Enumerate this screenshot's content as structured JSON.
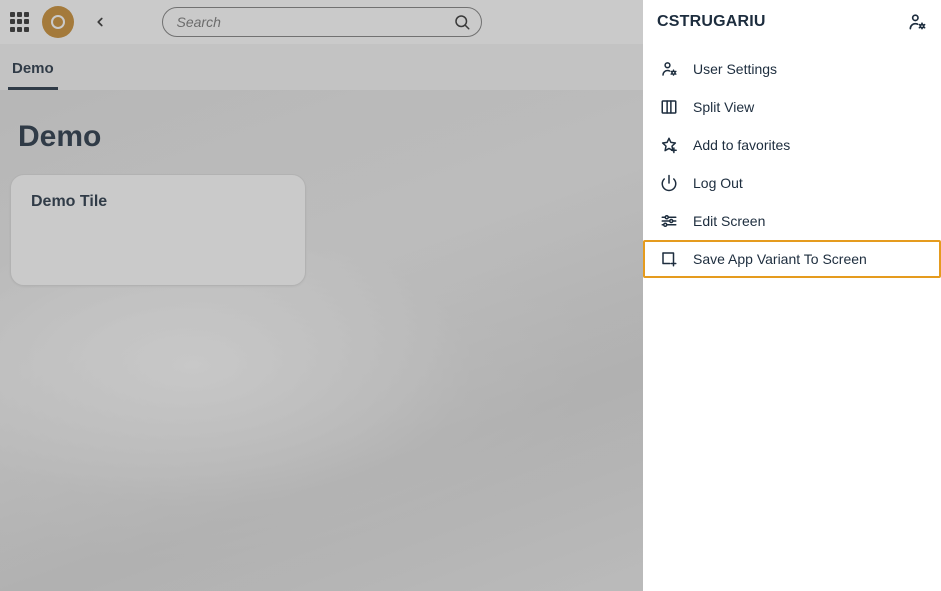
{
  "header": {
    "search_placeholder": "Search",
    "tab_label": "Demo"
  },
  "page": {
    "title": "Demo",
    "tile_title": "Demo Tile"
  },
  "panel": {
    "title": "CSTRUGARIU",
    "menu": {
      "user_settings": "User Settings",
      "split_view": "Split View",
      "add_to_favorites": "Add to favorites",
      "log_out": "Log Out",
      "edit_screen": "Edit Screen",
      "save_app_variant": "Save App Variant To Screen"
    }
  }
}
